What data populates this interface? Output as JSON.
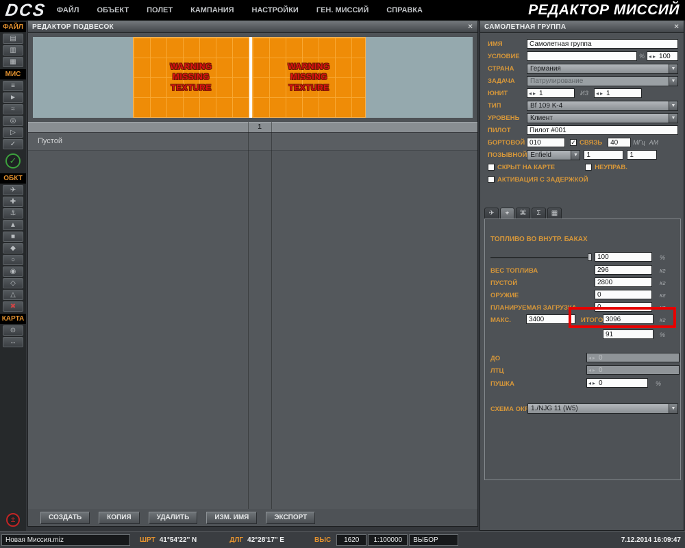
{
  "icons": {
    "close": "✕",
    "dropdown_arrow": "▼",
    "stepper_arrows": "◂▸",
    "check": "✓"
  },
  "units": {
    "percent": "%",
    "kg": "кг"
  },
  "titlebar": {
    "logo": "DCS",
    "menu": [
      "ФАЙЛ",
      "ОБЪЕКТ",
      "ПОЛЕТ",
      "КАМПАНИЯ",
      "НАСТРОЙКИ",
      "ГЕН. МИССИЙ",
      "СПРАВКА"
    ],
    "title": "РЕДАКТОР МИССИЙ"
  },
  "sidebar": {
    "sections": [
      {
        "label": "ФАЙЛ",
        "items": [
          {
            "name": "new-mission",
            "glyph": "▤"
          },
          {
            "name": "open-mission",
            "glyph": "▥"
          },
          {
            "name": "save-mission",
            "glyph": "▦"
          }
        ]
      },
      {
        "label": "МИС",
        "items": [
          {
            "name": "briefing",
            "glyph": "≡"
          },
          {
            "name": "mission-options",
            "glyph": "►"
          },
          {
            "name": "weather",
            "glyph": "≈"
          },
          {
            "name": "mission-goals",
            "glyph": "◎"
          },
          {
            "name": "triggers",
            "glyph": "▷"
          },
          {
            "name": "mission-check",
            "glyph": "✓"
          }
        ]
      },
      {
        "items": [
          {
            "name": "fly-mission",
            "glyph": "✓",
            "variant": "green-circle"
          }
        ]
      },
      {
        "label": "ОБКТ",
        "items": [
          {
            "name": "airplane-group",
            "glyph": "✈"
          },
          {
            "name": "helicopter-group",
            "glyph": "✚"
          },
          {
            "name": "ship-group",
            "glyph": "⚓"
          },
          {
            "name": "vehicle-group",
            "glyph": "▲"
          },
          {
            "name": "static-object",
            "glyph": "■"
          },
          {
            "name": "group-template",
            "glyph": "◆"
          },
          {
            "name": "trigger-zone",
            "glyph": "○"
          },
          {
            "name": "bullseye",
            "glyph": "◉"
          },
          {
            "name": "farp",
            "glyph": "◇"
          },
          {
            "name": "sead-zone",
            "glyph": "△"
          },
          {
            "name": "delete-object",
            "glyph": "✖",
            "variant": "red"
          }
        ]
      },
      {
        "label": "КАРТА",
        "items": [
          {
            "name": "map-options",
            "glyph": "⊙"
          },
          {
            "name": "distance-tool",
            "glyph": "↔"
          }
        ]
      },
      {
        "spacer": true,
        "items": [
          {
            "name": "connection-status",
            "glyph": "±",
            "variant": "red-circle"
          }
        ]
      }
    ]
  },
  "payload_window": {
    "title": "РЕДАКТОР ПОДВЕСОК",
    "missing_texture": "WARNING\nMISSING\nTEXTURE",
    "pylon_number": "1",
    "row_empty": "Пустой",
    "buttons": [
      "СОЗДАТЬ",
      "КОПИЯ",
      "УДАЛИТЬ",
      "ИЗМ. ИМЯ",
      "ЭКСПОРТ"
    ]
  },
  "group_panel": {
    "title": "САМОЛЕТНАЯ ГРУППА",
    "rows": {
      "name": {
        "label": "ИМЯ",
        "value": "Самолетная группа"
      },
      "condition": {
        "label": "УСЛОВИЕ",
        "value": "",
        "stepper": "100"
      },
      "country": {
        "label": "СТРАНА",
        "value": "Германия"
      },
      "task": {
        "label": "ЗАДАЧА",
        "value": "Патрулирование"
      },
      "unit": {
        "label": "ЮНИТ",
        "value": "1",
        "of": "ИЗ",
        "total": "1"
      },
      "type": {
        "label": "ТИП",
        "value": "Bf 109 K-4"
      },
      "skill": {
        "label": "УРОВЕНЬ",
        "value": "Клиент"
      },
      "pilot": {
        "label": "ПИЛОТ",
        "value": "Пилот #001"
      },
      "board": {
        "label": "БОРТОВОЙ",
        "value": "010",
        "comm_label": "СВЯЗЬ",
        "freq": "40",
        "freq_unit": "МГц",
        "modulation": "AM"
      },
      "callsign": {
        "label": "ПОЗЫВНОЙ",
        "value": "Enfield",
        "num1": "1",
        "num2": "1"
      },
      "hidden_label": "СКРЫТ НА КАРТЕ",
      "uncontrolled_label": "НЕУПРАВ.",
      "late_activation_label": "АКТИВАЦИЯ С ЗАДЕРЖКОЙ"
    },
    "tabs": [
      {
        "name": "tab-waypoints",
        "glyph": "✈"
      },
      {
        "name": "tab-payload",
        "glyph": "⌖"
      },
      {
        "name": "tab-systems",
        "glyph": "⌘"
      },
      {
        "name": "tab-summary",
        "glyph": "Σ"
      },
      {
        "name": "tab-preview",
        "glyph": "▦"
      }
    ],
    "fuel": {
      "title": "ТОПЛИВО ВО ВНУТР. БАКАХ",
      "fuel_pct": "100",
      "rows": [
        {
          "label": "ВЕС ТОПЛИВА",
          "value": "296"
        },
        {
          "label": "ПУСТОЙ",
          "value": "2800"
        },
        {
          "label": "ОРУЖИЕ",
          "value": "0"
        },
        {
          "label": "ПЛАНИРУЕМАЯ ЗАГРУЗКА",
          "value": "0"
        }
      ],
      "max_label": "МАКС.",
      "max_value": "3400",
      "total_label": "ИТОГО",
      "total_value": "3096",
      "total_pct": "91",
      "chaff_label": "ДО",
      "chaff_value": "0",
      "flare_label": "ЛТЦ",
      "flare_value": "0",
      "gun_label": "ПУШКА",
      "gun_value": "0",
      "livery_label": "СХЕМА ОКРАС",
      "livery_value": "1./NJG 11 (W5)"
    }
  },
  "statusbar": {
    "mission_name": "Новая Миссия.miz",
    "lat_label": "ШРТ",
    "lat_value": "41°54'22''  N",
    "lon_label": "ДЛГ",
    "lon_value": "42°28'17''  E",
    "alt_label": "ВЫС",
    "alt_value": "1620",
    "scale": "1:100000",
    "select_label": "ВЫБОР",
    "datetime": "7.12.2014 16:09:47"
  }
}
